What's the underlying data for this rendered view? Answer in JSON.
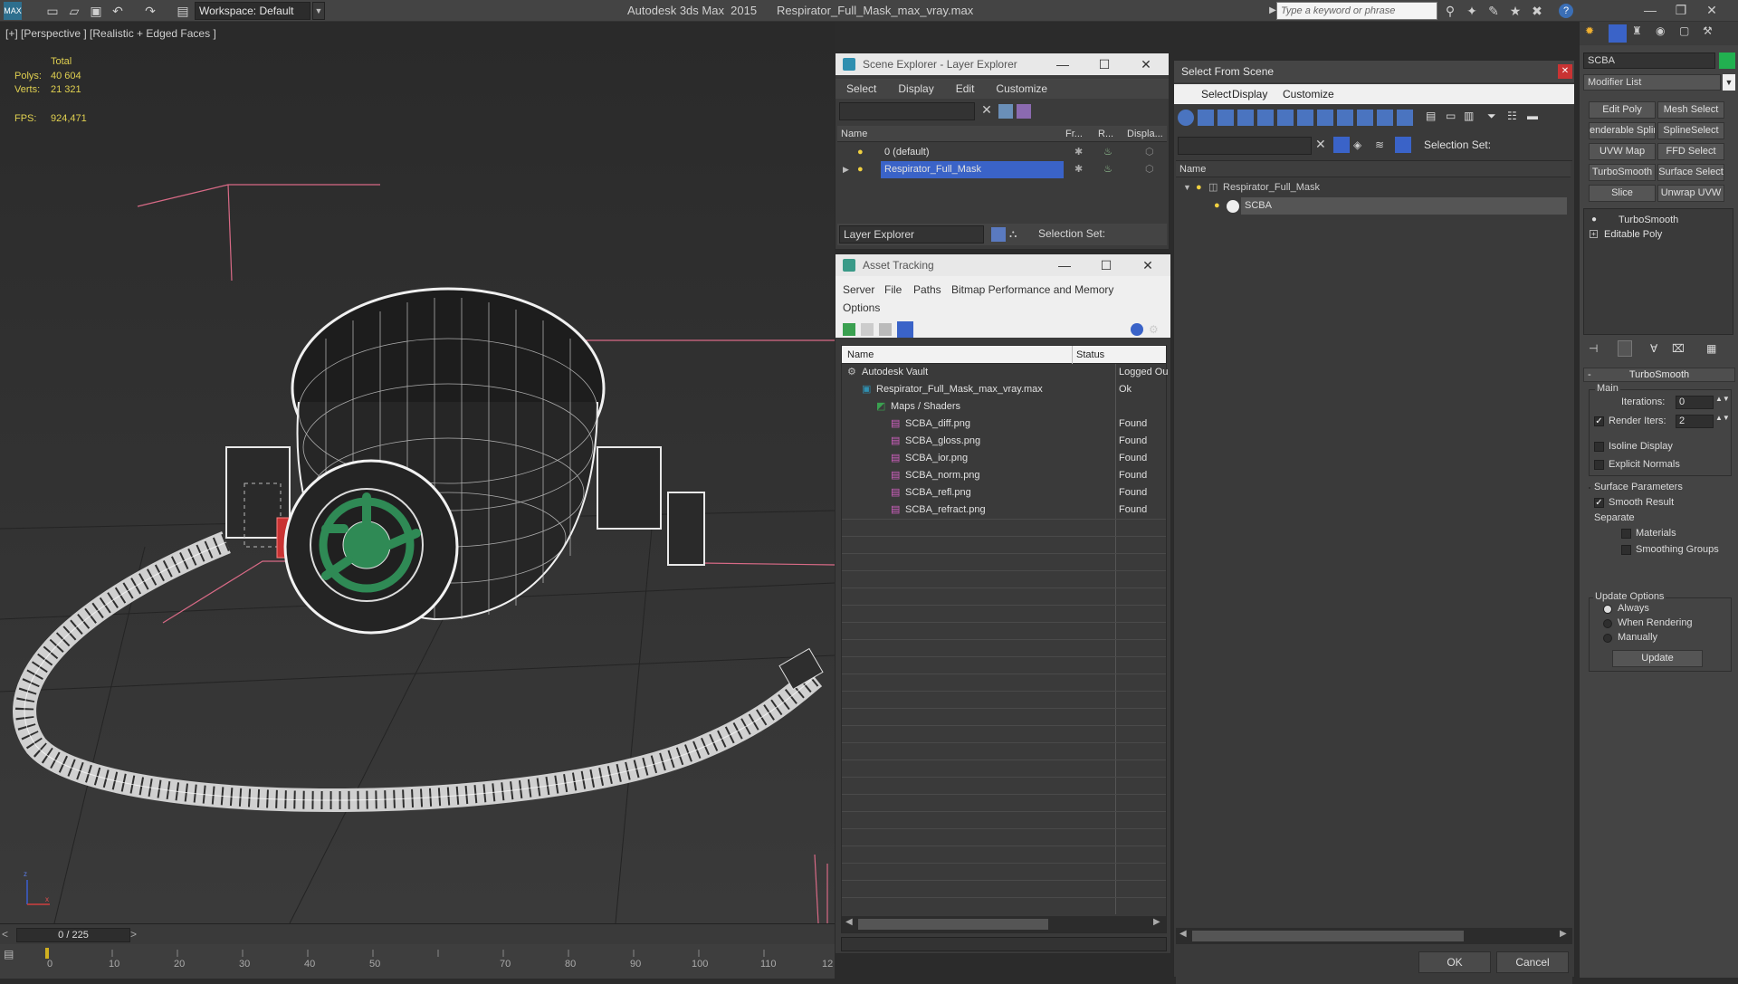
{
  "titlebar": {
    "workspace": "Workspace: Default",
    "app_title": "Autodesk 3ds Max  2015",
    "file_title": "Respirator_Full_Mask_max_vray.max",
    "search_placeholder": "Type a keyword or phrase"
  },
  "viewport": {
    "label": "[+] [Perspective ] [Realistic + Edged Faces ]",
    "stats": {
      "total_label": "Total",
      "polys_label": "Polys:",
      "polys_value": "40 604",
      "verts_label": "Verts:",
      "verts_value": "21 321",
      "fps_label": "FPS:",
      "fps_value": "924,471"
    }
  },
  "scene_explorer": {
    "title": "Scene Explorer - Layer Explorer",
    "menu": [
      "Select",
      "Display",
      "Edit",
      "Customize"
    ],
    "columns": [
      "Name",
      "Fr...",
      "R...",
      "Displa..."
    ],
    "rows": [
      "0 (default)",
      "Respirator_Full_Mask"
    ],
    "footer_dropdown": "Layer Explorer",
    "selection_set_label": "Selection Set:"
  },
  "asset_tracking": {
    "title": "Asset Tracking",
    "menu": [
      "Server",
      "File",
      "Paths",
      "Bitmap Performance and Memory"
    ],
    "menu2": "Options",
    "columns": [
      "Name",
      "Status"
    ],
    "rows": [
      {
        "name": "Autodesk Vault",
        "status": "Logged Ou"
      },
      {
        "name": "Respirator_Full_Mask_max_vray.max",
        "status": "Ok"
      },
      {
        "name": "Maps / Shaders",
        "status": ""
      },
      {
        "name": "SCBA_diff.png",
        "status": "Found"
      },
      {
        "name": "SCBA_gloss.png",
        "status": "Found"
      },
      {
        "name": "SCBA_ior.png",
        "status": "Found"
      },
      {
        "name": "SCBA_norm.png",
        "status": "Found"
      },
      {
        "name": "SCBA_refl.png",
        "status": "Found"
      },
      {
        "name": "SCBA_refract.png",
        "status": "Found"
      }
    ]
  },
  "select_from_scene": {
    "title": "Select From Scene",
    "menu": [
      "Select",
      "Display",
      "Customize"
    ],
    "selection_set_label": "Selection Set:",
    "column": "Name",
    "rows": [
      "Respirator_Full_Mask",
      "SCBA"
    ],
    "ok": "OK",
    "cancel": "Cancel"
  },
  "modify_panel": {
    "object_name": "SCBA",
    "modifier_list": "Modifier List",
    "buttons": [
      "Edit Poly",
      "Mesh Select",
      "enderable Splir",
      "SplineSelect",
      "UVW Map",
      "FFD Select",
      "TurboSmooth",
      "Surface Select",
      "Slice",
      "Unwrap UVW"
    ],
    "stack": [
      "TurboSmooth",
      "Editable Poly"
    ],
    "rollout_title": "TurboSmooth",
    "main_group": "Main",
    "iterations_label": "Iterations:",
    "iterations_value": "0",
    "render_iters_label": "Render Iters:",
    "render_iters_value": "2",
    "isoline_display": "Isoline Display",
    "explicit_normals": "Explicit Normals",
    "surface_params": "Surface Parameters",
    "smooth_result": "Smooth Result",
    "separate": "Separate",
    "materials": "Materials",
    "smoothing_groups": "Smoothing Groups",
    "update_options": "Update Options",
    "always": "Always",
    "when_rendering": "When Rendering",
    "manually": "Manually",
    "update_button": "Update"
  },
  "timeline": {
    "frame_counter": "0 / 225",
    "ticks": [
      "0",
      "10",
      "20",
      "30",
      "40",
      "50",
      "70",
      "80",
      "90",
      "100",
      "110",
      "12"
    ]
  },
  "colors": {
    "selection_blue": "#3a63c8",
    "status_yellow": "#e0d050",
    "frame_pink": "#d86a86"
  }
}
